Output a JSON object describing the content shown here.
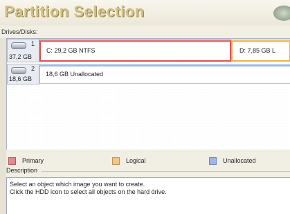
{
  "header": {
    "title": "Partition Selection",
    "logo_icon": "app-logo-icon"
  },
  "drives_label": "Drives/Disks:",
  "disks": [
    {
      "number": "1",
      "size": "37,2 GB",
      "partitions": [
        {
          "label": "C: 29,2 GB  NTFS",
          "kind": "Primary",
          "selected": true
        },
        {
          "label": "D: 7,85 GB  L",
          "kind": "Logical",
          "selected": false
        }
      ]
    },
    {
      "number": "2",
      "size": "18,6 GB",
      "partitions": [
        {
          "label": "18,6 GB  Unallocated",
          "kind": "Unallocated",
          "selected": false
        }
      ]
    }
  ],
  "legend": [
    {
      "label": "Primary",
      "color": "#e08a93"
    },
    {
      "label": "Logical",
      "color": "#f0c48a"
    },
    {
      "label": "Unallocated",
      "color": "#9fb7e6"
    }
  ],
  "description": {
    "label": "Description",
    "lines": [
      "Select an object which image you want to create.",
      "Click the HDD icon to select all objects on the hard drive."
    ]
  },
  "colors": {
    "primary_border": "#d9534f",
    "logical_border": "#e8b24a",
    "unallocated_border": "#7f9fd6",
    "title": "#d3c186"
  }
}
